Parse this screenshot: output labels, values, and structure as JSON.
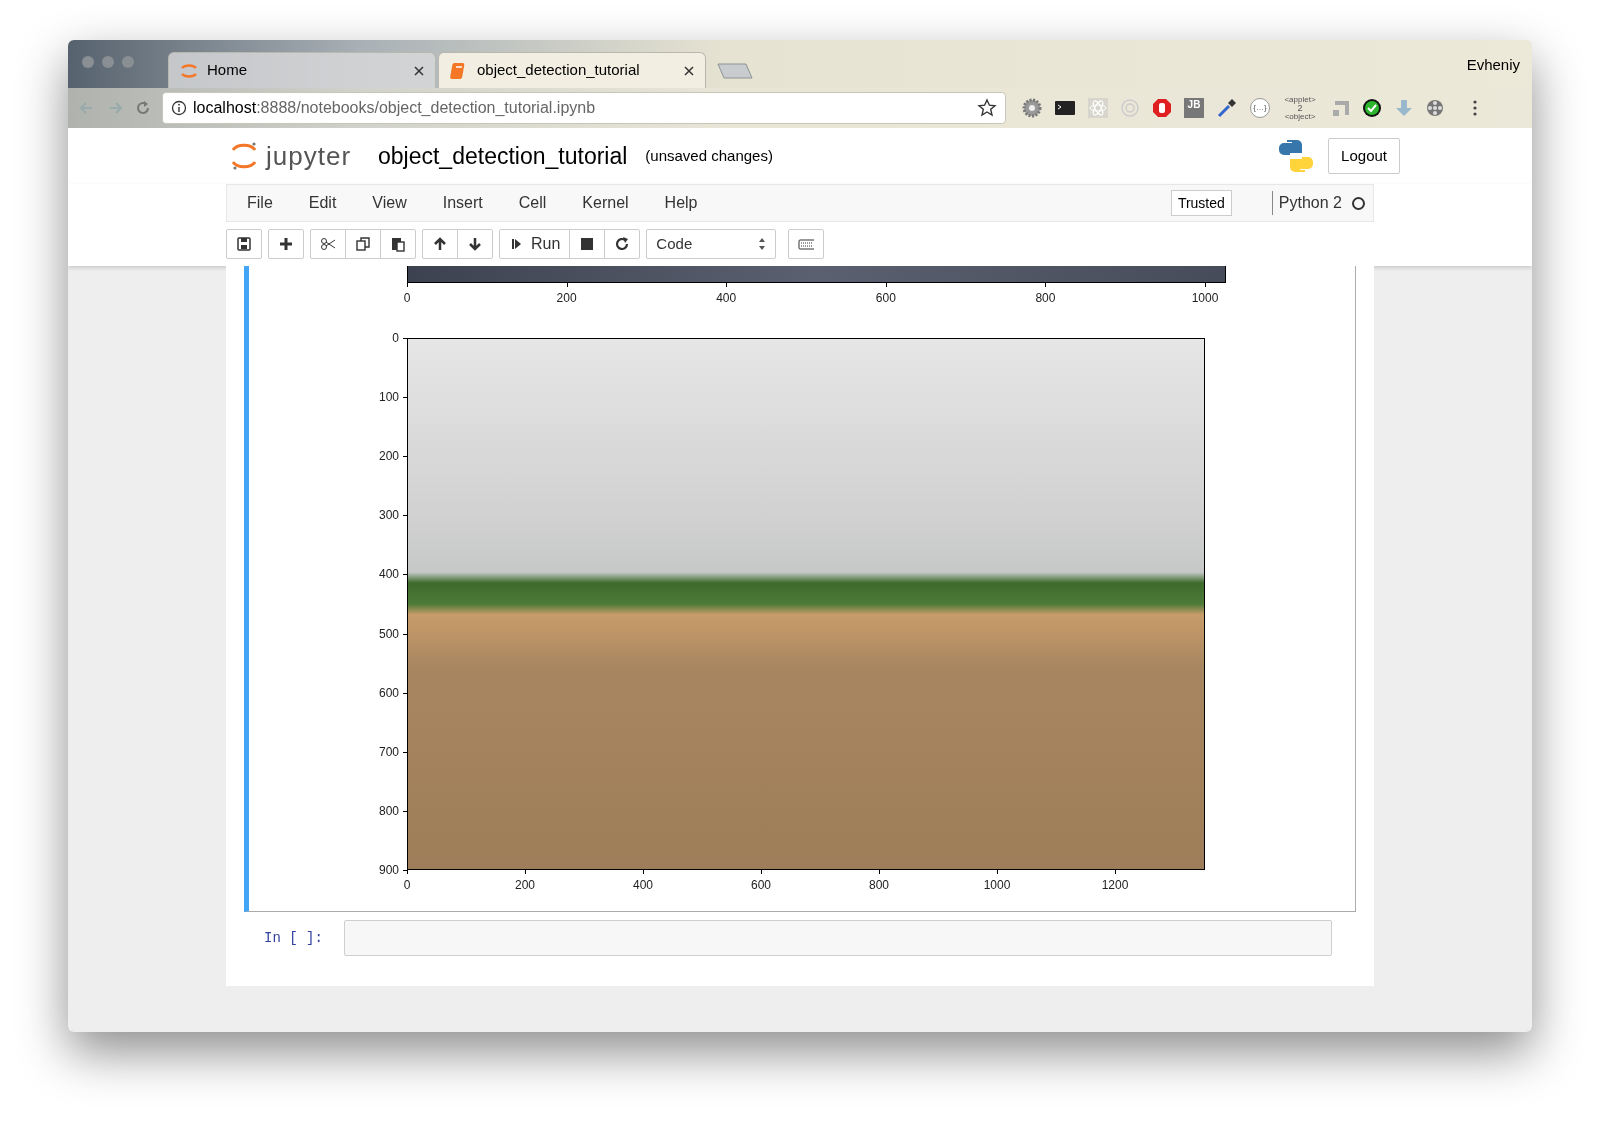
{
  "browser": {
    "tabs": [
      {
        "title": "Home",
        "kind": "jupyter",
        "selected": false
      },
      {
        "title": "object_detection_tutorial",
        "kind": "notebook",
        "selected": true
      }
    ],
    "profile": "Evheniy",
    "url": {
      "host": "localhost",
      "path": ":8888/notebooks/object_detection_tutorial.ipynb"
    },
    "extensions": [
      {
        "kind": "gear"
      },
      {
        "kind": "terminal"
      },
      {
        "kind": "atom"
      },
      {
        "kind": "ring"
      },
      {
        "kind": "hand"
      },
      {
        "kind": "badge",
        "label": "JB"
      },
      {
        "kind": "dropper"
      },
      {
        "kind": "braces",
        "label": "{…}"
      },
      {
        "kind": "applet",
        "caption_top": "<applet>",
        "label": "2",
        "caption_bottom": "<object>"
      },
      {
        "kind": "squares"
      },
      {
        "kind": "check"
      },
      {
        "kind": "download"
      },
      {
        "kind": "film"
      }
    ]
  },
  "notebook": {
    "logo": "jupyter",
    "name": "object_detection_tutorial",
    "status": "(unsaved changes)",
    "logout": "Logout",
    "menu": [
      "File",
      "Edit",
      "View",
      "Insert",
      "Cell",
      "Kernel",
      "Help"
    ],
    "trusted": "Trusted",
    "kernel": "Python 2",
    "kernel_busy": false,
    "toolbar": {
      "run": "Run",
      "cell_type": "Code"
    }
  },
  "output": {
    "top_axis": {
      "xticks": [
        "0",
        "200",
        "400",
        "600",
        "800",
        "1000"
      ]
    },
    "plot": {
      "xticks": [
        "0",
        "200",
        "400",
        "600",
        "800",
        "1000",
        "1200"
      ],
      "yticks": [
        "0",
        "100",
        "200",
        "300",
        "400",
        "500",
        "600",
        "700",
        "800",
        "900"
      ]
    }
  },
  "next_cell": {
    "prompt": "In [ ]:"
  }
}
